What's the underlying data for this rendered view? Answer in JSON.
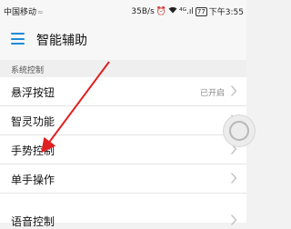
{
  "status_bar": {
    "carrier": "中国移动",
    "speed": "35B/s",
    "icons": [
      "alarm-icon",
      "wifi-icon",
      "signal-icon"
    ],
    "signal_label": "⁴ᴳ.ıl",
    "battery": "77",
    "time": "下午3:55"
  },
  "app_bar": {
    "title": "智能辅助"
  },
  "section": {
    "title": "系统控制"
  },
  "items": [
    {
      "label": "悬浮按钮",
      "value": "已开启"
    },
    {
      "label": "智灵功能",
      "value": ""
    },
    {
      "label": "手势控制",
      "value": ""
    },
    {
      "label": "单手操作",
      "value": ""
    },
    {
      "label": "语音控制",
      "value": ""
    }
  ],
  "colors": {
    "accent": "#1e8ad6",
    "arrow": "#e02020"
  }
}
